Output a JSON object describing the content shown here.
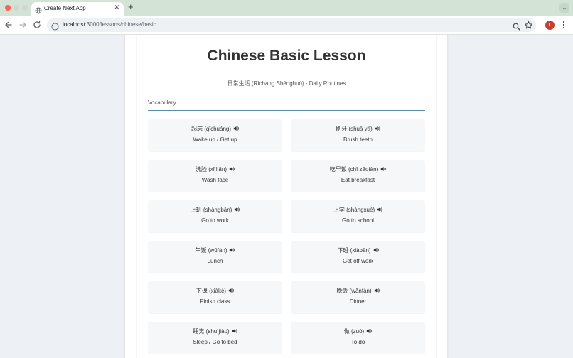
{
  "browser": {
    "tab_title": "Create Next App",
    "url_host": "localhost",
    "url_rest": ":3000/lessons/chinese/basic",
    "profile_initial": "L"
  },
  "page": {
    "title": "Chinese Basic Lesson",
    "subtitle": "日常生活 (Rìcháng Shēnghuó) - Daily Routines",
    "section_label": "Vocabulary"
  },
  "vocabulary": [
    {
      "word": "起床 (qǐchuáng)",
      "meaning": "Wake up / Get up"
    },
    {
      "word": "刷牙 (shuā yá)",
      "meaning": "Brush teeth"
    },
    {
      "word": "洗脸 (xǐ liǎn)",
      "meaning": "Wash face"
    },
    {
      "word": "吃早饭 (chī zǎofàn)",
      "meaning": "Eat breakfast"
    },
    {
      "word": "上班 (shàngbān)",
      "meaning": "Go to work"
    },
    {
      "word": "上学 (shàngxué)",
      "meaning": "Go to school"
    },
    {
      "word": "午饭 (wǔfàn)",
      "meaning": "Lunch"
    },
    {
      "word": "下班 (xiàbān)",
      "meaning": "Get off work"
    },
    {
      "word": "下课 (xiàkè)",
      "meaning": "Finish class"
    },
    {
      "word": "晚饭 (wǎnfàn)",
      "meaning": "Dinner"
    },
    {
      "word": "睡觉 (shuìjiào)",
      "meaning": "Sleep / Go to bed"
    },
    {
      "word": "做 (zuò)",
      "meaning": "To do"
    }
  ],
  "colors": {
    "accent_rule": "#5a8fa3",
    "card_bg": "#f6f7f8",
    "tabbar_bg": "#d3e3d6"
  },
  "icons": {
    "speaker": "speaker-icon"
  }
}
